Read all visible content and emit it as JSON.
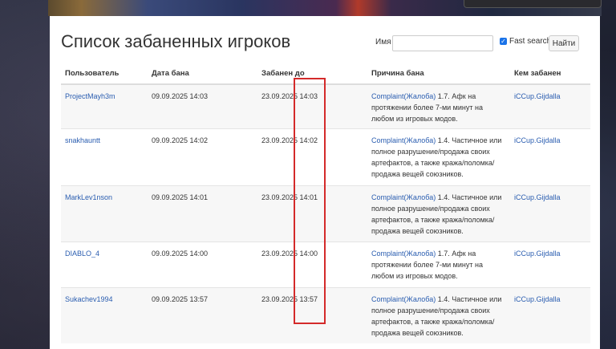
{
  "page": {
    "title": "Список забаненных игроков"
  },
  "search": {
    "name_label": "Имя",
    "name_value": "",
    "fast_search_label": "Fast search",
    "fast_search_checked": true,
    "find_button": "Найти"
  },
  "table": {
    "headers": [
      "Пользователь",
      "Дата бана",
      "Забанен до",
      "Причина бана",
      "Кем забанен"
    ],
    "rows": [
      {
        "user": "ProjectMayh3m",
        "ban_date": "09.09.2025 14:03",
        "banned_until": "23.09.2025 14:03",
        "reason_link": "Complaint(Жалоба)",
        "reason_text": "1.7. Афк на протяжении более 7-ми минут на любом из игровых модов.",
        "banned_by": "iCCup.Gijdalla"
      },
      {
        "user": "snakhauntt",
        "ban_date": "09.09.2025 14:02",
        "banned_until": "23.09.2025 14:02",
        "reason_link": "Complaint(Жалоба)",
        "reason_text": "1.4. Частичное или полное разрушение/продажа своих артефактов, а также кража/поломка/ продажа вещей союзников.",
        "banned_by": "iCCup.Gijdalla"
      },
      {
        "user": "MarkLev1nson",
        "ban_date": "09.09.2025 14:01",
        "banned_until": "23.09.2025 14:01",
        "reason_link": "Complaint(Жалоба)",
        "reason_text": "1.4. Частичное или полное разрушение/продажа своих артефактов, а также кража/поломка/ продажа вещей союзников.",
        "banned_by": "iCCup.Gijdalla"
      },
      {
        "user": "DIABLO_4",
        "ban_date": "09.09.2025 14:00",
        "banned_until": "23.09.2025 14:00",
        "reason_link": "Complaint(Жалоба)",
        "reason_text": "1.7. Афк на протяжении более 7-ми минут на любом из игровых модов.",
        "banned_by": "iCCup.Gijdalla"
      },
      {
        "user": "Sukachev1994",
        "ban_date": "09.09.2025 13:57",
        "banned_until": "23.09.2025 13:57",
        "reason_link": "Complaint(Жалоба)",
        "reason_text": "1.4. Частичное или полное разрушение/продажа своих артефактов, а также кража/поломка/ продажа вещей союзников.",
        "banned_by": "iCCup.Gijdalla"
      }
    ]
  },
  "colors": {
    "link": "#2a5db0",
    "highlight_border": "#d42a2a",
    "checkbox": "#1a73e8"
  }
}
